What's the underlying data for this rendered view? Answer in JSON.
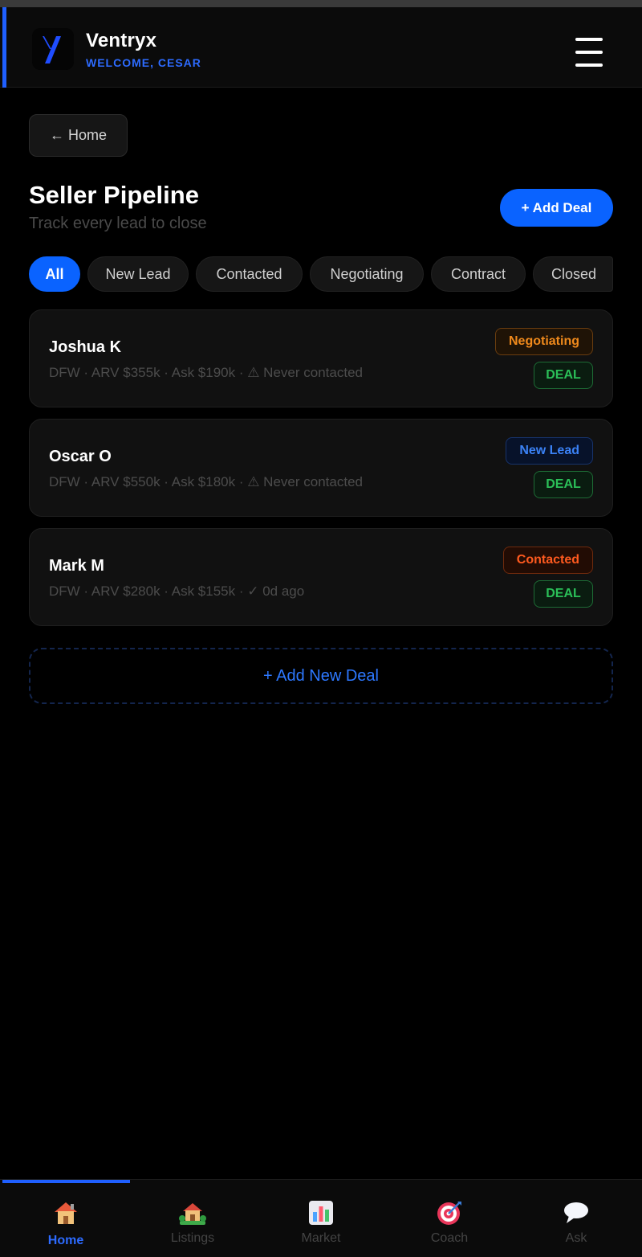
{
  "header": {
    "app_name": "Ventryx",
    "welcome": "WELCOME, CESAR",
    "logo_icon": "ventryx-logo",
    "menu_icon": "hamburger-menu-icon"
  },
  "back_button": {
    "label": "← Home"
  },
  "page": {
    "title": "Seller Pipeline",
    "subtitle": "Track every lead to close",
    "add_deal_label": "+ Add Deal"
  },
  "filters": {
    "selected": "All",
    "tabs": [
      {
        "label": "All"
      },
      {
        "label": "New Lead"
      },
      {
        "label": "Contacted"
      },
      {
        "label": "Negotiating"
      },
      {
        "label": "Contract"
      },
      {
        "label": "Closed"
      }
    ]
  },
  "deals": [
    {
      "name": "Joshua K",
      "meta": "DFW · ARV $355k · Ask $190k · ⚠ Never contacted",
      "status": "Negotiating",
      "status_color": "#f08a1c",
      "tag": "DEAL"
    },
    {
      "name": "Oscar O",
      "meta": "DFW · ARV $550k · Ask $180k · ⚠ Never contacted",
      "status": "New Lead",
      "status_color": "#3b82f6",
      "tag": "DEAL"
    },
    {
      "name": "Mark M",
      "meta": "DFW · ARV $280k · Ask $155k · ✓ 0d ago",
      "status": "Contacted",
      "status_color": "#ff5a1f",
      "tag": "DEAL"
    }
  ],
  "add_new_deal_label": "+ Add New Deal",
  "bottom_nav": {
    "active": "Home",
    "items": [
      {
        "label": "Home",
        "icon": "house-icon"
      },
      {
        "label": "Listings",
        "icon": "house-with-garden-icon"
      },
      {
        "label": "Market",
        "icon": "bar-chart-icon"
      },
      {
        "label": "Coach",
        "icon": "target-icon"
      },
      {
        "label": "Ask",
        "icon": "speech-bubble-icon"
      }
    ]
  },
  "colors": {
    "accent": "#0a63ff",
    "background": "#000000",
    "card": "#111111",
    "deal_green": "#2bbf58"
  }
}
